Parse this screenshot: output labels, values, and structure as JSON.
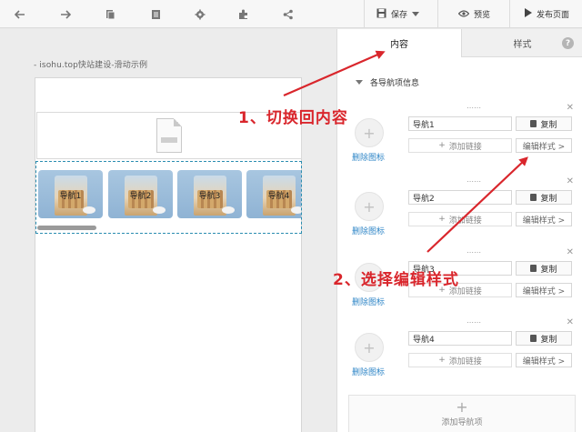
{
  "toolbar": {
    "save_label": "保存",
    "preview_label": "预览",
    "publish_label": "发布页面",
    "icons": [
      "undo-icon",
      "redo-icon",
      "copy-page-icon",
      "page-list-icon",
      "settings-icon",
      "plugin-icon",
      "share-icon"
    ]
  },
  "canvas": {
    "page_title": "- isohu.top快站建设-滑动示例",
    "nav_items": [
      {
        "label": "导航1"
      },
      {
        "label": "导航2"
      },
      {
        "label": "导航3"
      },
      {
        "label": "导航4"
      }
    ]
  },
  "panel": {
    "tab_content": "内容",
    "tab_style": "样式",
    "help_label": "?",
    "section_title": "各导航项信息",
    "cards": [
      {
        "name": "导航1",
        "copy_label": "复制",
        "add_link_label": "添加链接",
        "edit_style_label": "编辑样式 >",
        "delete_icon_label": "删除图标"
      },
      {
        "name": "导航2",
        "copy_label": "复制",
        "add_link_label": "添加链接",
        "edit_style_label": "编辑样式 >",
        "delete_icon_label": "删除图标"
      },
      {
        "name": "导航3",
        "copy_label": "复制",
        "add_link_label": "添加链接",
        "edit_style_label": "编辑样式 >",
        "delete_icon_label": "删除图标"
      },
      {
        "name": "导航4",
        "copy_label": "复制",
        "add_link_label": "添加链接",
        "edit_style_label": "编辑样式 >",
        "delete_icon_label": "删除图标"
      }
    ],
    "add_nav_label": "添加导航项"
  },
  "annotations": {
    "step1": "1、切换回内容",
    "step2": "2、选择编辑样式",
    "color": "#d9262c"
  },
  "colors": {
    "accent_blue": "#2f86c7",
    "selection_border": "#2a8db0"
  }
}
